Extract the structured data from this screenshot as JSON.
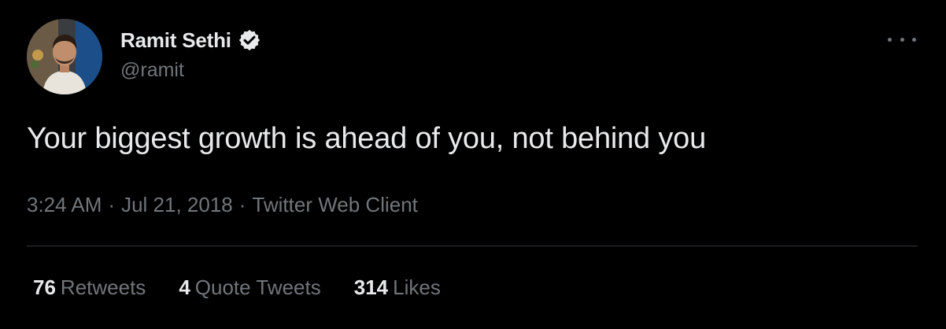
{
  "author": {
    "name": "Ramit Sethi",
    "handle": "@ramit",
    "verified": true,
    "avatar": "profile-photo"
  },
  "tweet": {
    "text": "Your biggest growth is ahead of you, not behind you",
    "time": "3:24 AM",
    "date": "Jul 21, 2018",
    "source": "Twitter Web Client",
    "separator": "·"
  },
  "stats": {
    "retweets": {
      "count": "76",
      "label": "Retweets"
    },
    "quotes": {
      "count": "4",
      "label": "Quote Tweets"
    },
    "likes": {
      "count": "314",
      "label": "Likes"
    }
  },
  "icons": {
    "verified": "verified-badge-icon",
    "more": "more-options-icon"
  },
  "colors": {
    "background": "#000000",
    "primary_text": "#e7e9ea",
    "secondary_text": "#71767b",
    "divider": "#2f3336"
  }
}
